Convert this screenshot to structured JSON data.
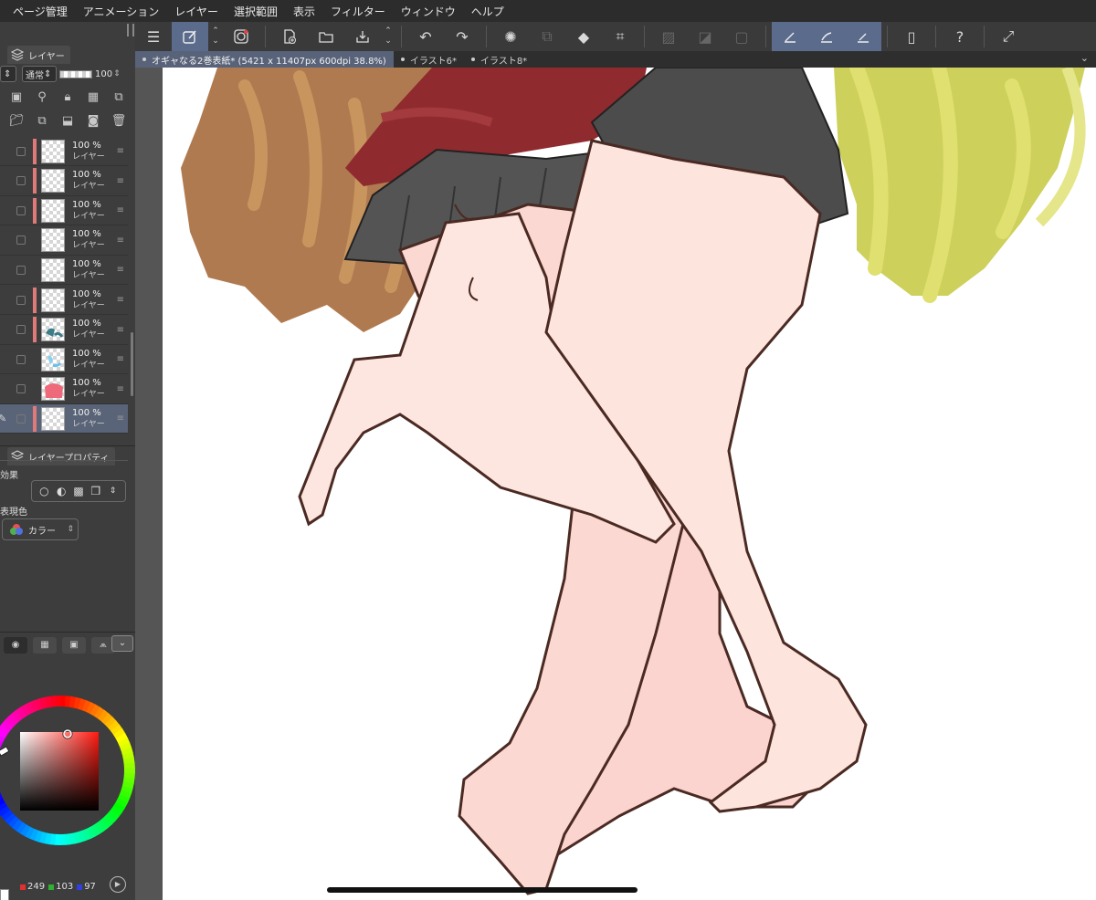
{
  "menu": [
    "ページ管理",
    "アニメーション",
    "レイヤー",
    "選択範囲",
    "表示",
    "フィルター",
    "ウィンドウ",
    "ヘルプ"
  ],
  "layer_panel": {
    "tab_label": "レイヤー",
    "blend_mode": "通常",
    "opacity": "100",
    "layers": [
      {
        "opacity": "100 %",
        "name": "レイヤー",
        "tag": true,
        "thumb": "checker",
        "selected": false
      },
      {
        "opacity": "100 %",
        "name": "レイヤー",
        "tag": true,
        "thumb": "checker",
        "selected": false
      },
      {
        "opacity": "100 %",
        "name": "レイヤー",
        "tag": true,
        "thumb": "checker",
        "selected": false
      },
      {
        "opacity": "100 %",
        "name": "レイヤー",
        "tag": false,
        "thumb": "checker",
        "selected": false
      },
      {
        "opacity": "100 %",
        "name": "レイヤー",
        "tag": false,
        "thumb": "checker",
        "selected": false
      },
      {
        "opacity": "100 %",
        "name": "レイヤー",
        "tag": true,
        "thumb": "checker",
        "selected": false
      },
      {
        "opacity": "100 %",
        "name": "レイヤー",
        "tag": true,
        "thumb": "teal",
        "selected": false
      },
      {
        "opacity": "100 %",
        "name": "レイヤー",
        "tag": false,
        "thumb": "blue",
        "selected": false
      },
      {
        "opacity": "100 %",
        "name": "レイヤー",
        "tag": false,
        "thumb": "pink",
        "selected": false
      },
      {
        "opacity": "100 %",
        "name": "レイヤー",
        "tag": true,
        "thumb": "checker",
        "selected": true
      }
    ]
  },
  "layer_property": {
    "tab_label": "レイヤープロパティ",
    "effect_label": "効果",
    "expression_color_label": "表現色",
    "color_mode": "カラー"
  },
  "color_panel": {
    "r": "249",
    "g": "103",
    "b": "97",
    "current_color": "#f96761"
  },
  "document_tabs": [
    {
      "label": "オギャなる2巻表紙* (5421 x 11407px 600dpi 38.8%)",
      "active": true
    },
    {
      "label": "イラスト6*",
      "active": false
    },
    {
      "label": "イラスト8*",
      "active": false
    }
  ],
  "toolbar_icons": [
    "menu-icon",
    "pen-tool-icon",
    "swirl-icon",
    "new-page-icon",
    "open-folder-icon",
    "save-icon",
    "undo-icon",
    "redo-icon",
    "loading-icon",
    "transform-icon",
    "fill-icon",
    "crop-icon",
    "deselect-icon",
    "invert-icon",
    "border-icon",
    "ruler-snap-icon",
    "curve-snap-icon",
    "line-snap-icon",
    "device-icon",
    "help-icon",
    "fullscreen-icon"
  ]
}
